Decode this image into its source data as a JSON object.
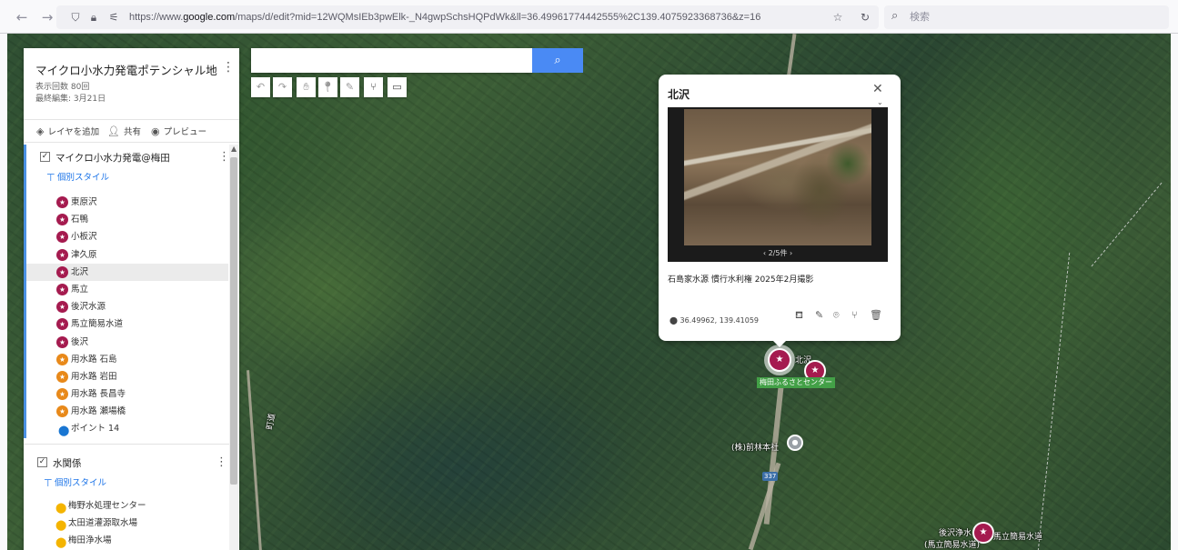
{
  "browser": {
    "url_prefix": "https://www.",
    "url_host": "google.com",
    "url_path": "/maps/d/edit?mid=12WQMsIEb3pwElk-_N4gwpSchsHQPdWk&ll=36.49961774442555%2C139.4075923368736&z=16",
    "search_placeholder": "検索"
  },
  "panel": {
    "title": "マイクロ小水力発電ポテンシャル地…",
    "views": "表示回数 80回",
    "last_edit": "最終編集: 3月21日",
    "toolbar": {
      "add_layer": "レイヤを追加",
      "share": "共有",
      "preview": "プレビュー"
    }
  },
  "layers": [
    {
      "name": "マイクロ小水力発電@梅田",
      "style": "個別スタイル",
      "items": [
        {
          "label": "東原沢",
          "type": "red"
        },
        {
          "label": "石鴨",
          "type": "red"
        },
        {
          "label": "小板沢",
          "type": "red"
        },
        {
          "label": "津久原",
          "type": "red"
        },
        {
          "label": "北沢",
          "type": "red",
          "active": true
        },
        {
          "label": "馬立",
          "type": "red"
        },
        {
          "label": "後沢水源",
          "type": "red"
        },
        {
          "label": "馬立簡易水道",
          "type": "red"
        },
        {
          "label": "後沢",
          "type": "red"
        },
        {
          "label": "用水路 石島",
          "type": "orange"
        },
        {
          "label": "用水路 岩田",
          "type": "orange"
        },
        {
          "label": "用水路 長昌寺",
          "type": "orange"
        },
        {
          "label": "用水路 瀬場橋",
          "type": "orange"
        },
        {
          "label": "ポイント 14",
          "type": "blue"
        }
      ]
    },
    {
      "name": "水関係",
      "style": "個別スタイル",
      "items": [
        {
          "label": "梅野水処理センター",
          "type": "yellow"
        },
        {
          "label": "太田道灌源取水場",
          "type": "yellow"
        },
        {
          "label": "梅田浄水場",
          "type": "yellow"
        }
      ]
    }
  ],
  "info": {
    "title": "北沢",
    "photo_counter": "2/5件",
    "description": "石島家水源 慣行水利権 2025年2月撮影",
    "coords": "36.49962, 139.41059"
  },
  "map_labels": {
    "near_marker": "北沢",
    "green": "梅田ふるさとセンター",
    "company": "(株)前林本社",
    "route": "337",
    "bottom1": "後沢浄水",
    "bottom2": "(馬立簡易水道)",
    "bottom3": "馬立簡易水道",
    "road_label": "町道"
  },
  "icons": {
    "back": "arrow-left-icon",
    "forward": "arrow-right-icon",
    "shield": "shield-icon",
    "lock": "lock-icon",
    "search": "search-icon",
    "star": "star-icon",
    "reload": "reload-icon"
  }
}
